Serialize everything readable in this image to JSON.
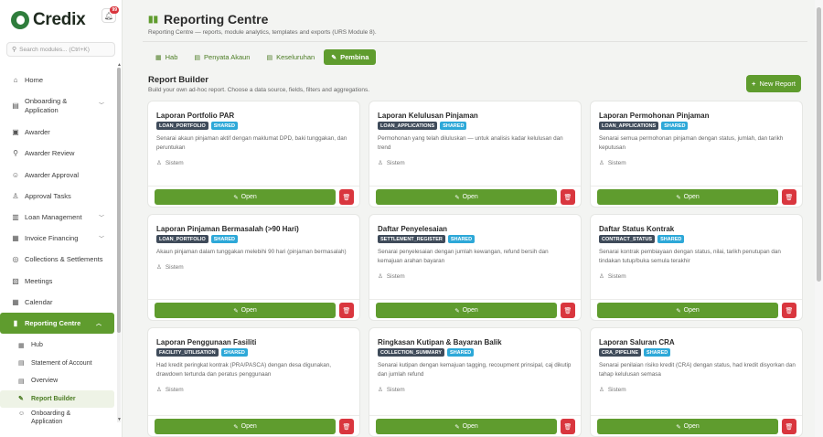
{
  "brand": {
    "name": "Credix",
    "notif_count": "99"
  },
  "search": {
    "placeholder": "Search modules... (Ctrl+K)"
  },
  "sidebar": {
    "items": [
      {
        "label": "Home",
        "icon": "home-icon",
        "glyph": "⌂"
      },
      {
        "label": "Onboarding & Application",
        "icon": "document-icon",
        "glyph": "▤",
        "chevron": true
      },
      {
        "label": "Awarder",
        "icon": "clipboard-icon",
        "glyph": "▣"
      },
      {
        "label": "Awarder Review",
        "icon": "user-search-icon",
        "glyph": "⚲"
      },
      {
        "label": "Awarder Approval",
        "icon": "user-check-icon",
        "glyph": "☺"
      },
      {
        "label": "Approval Tasks",
        "icon": "user-icon",
        "glyph": "♙"
      },
      {
        "label": "Loan Management",
        "icon": "bank-icon",
        "glyph": "▥",
        "chevron": true
      },
      {
        "label": "Invoice Financing",
        "icon": "invoice-icon",
        "glyph": "▦",
        "chevron": true
      },
      {
        "label": "Collections & Settlements",
        "icon": "coins-icon",
        "glyph": "◎"
      },
      {
        "label": "Meetings",
        "icon": "meeting-icon",
        "glyph": "▧"
      },
      {
        "label": "Calendar",
        "icon": "calendar-icon",
        "glyph": "▦"
      },
      {
        "label": "Reporting Centre",
        "icon": "chart-icon",
        "glyph": "▮",
        "chevron": true
      }
    ],
    "sub_items": [
      {
        "label": "Hub",
        "icon": "grid-icon",
        "glyph": "▦"
      },
      {
        "label": "Statement of Account",
        "icon": "statement-icon",
        "glyph": "▤"
      },
      {
        "label": "Overview",
        "icon": "overview-icon",
        "glyph": "▤"
      },
      {
        "label": "Report Builder",
        "icon": "wrench-icon",
        "glyph": "✎"
      },
      {
        "label": "Onboarding & Application",
        "icon": "users-icon",
        "glyph": "☺"
      }
    ]
  },
  "page": {
    "title": "Reporting Centre",
    "subtitle": "Reporting Centre — reports, module analytics, templates and exports (URS Module 8).",
    "tabs": [
      {
        "label": "Hab",
        "glyph": "▦"
      },
      {
        "label": "Penyata Akaun",
        "glyph": "▤"
      },
      {
        "label": "Keseluruhan",
        "glyph": "▤"
      },
      {
        "label": "Pembina",
        "glyph": "✎"
      }
    ],
    "section_title": "Report Builder",
    "section_subtitle": "Build your own ad-hoc report. Choose a data source, fields, filters and aggregations.",
    "new_report_label": "New Report"
  },
  "labels": {
    "shared": "Shared",
    "owner": "Sistem",
    "open": "Open"
  },
  "reports": [
    {
      "title": "Laporan Portfolio PAR",
      "source": "LOAN_PORTFOLIO",
      "desc": "Senarai akaun pinjaman aktif dengan maklumat DPD, baki tunggakan, dan peruntukan"
    },
    {
      "title": "Laporan Kelulusan Pinjaman",
      "source": "LOAN_APPLICATIONS",
      "desc": "Permohonan yang telah diluluskan — untuk analisis kadar kelulusan dan trend"
    },
    {
      "title": "Laporan Permohonan Pinjaman",
      "source": "LOAN_APPLICATIONS",
      "desc": "Senarai semua permohonan pinjaman dengan status, jumlah, dan tarikh keputusan"
    },
    {
      "title": "Laporan Pinjaman Bermasalah (>90 Hari)",
      "source": "LOAN_PORTFOLIO",
      "desc": "Akaun pinjaman dalam tunggakan melebihi 90 hari (pinjaman bermasalah)"
    },
    {
      "title": "Daftar Penyelesaian",
      "source": "SETTLEMENT_REGISTER",
      "desc": "Senarai penyelesaian dengan jumlah kewangan, refund bersih dan kemajuan arahan bayaran"
    },
    {
      "title": "Daftar Status Kontrak",
      "source": "CONTRACT_STATUS",
      "desc": "Senarai kontrak pembiayaan dengan status, nilai, tarikh penutupan dan tindakan tutup/buka semula terakhir"
    },
    {
      "title": "Laporan Penggunaan Fasiliti",
      "source": "FACILITY_UTILISATION",
      "desc": "Had kredit peringkat kontrak (PRA/PASCA) dengan desa digunakan, drawdown tertunda dan peratus penggunaan"
    },
    {
      "title": "Ringkasan Kutipan & Bayaran Balik",
      "source": "COLLECTION_SUMMARY",
      "desc": "Senarai kutipan dengan kemajuan tagging, recoupment prinsipal, caj dikutip dan jumlah refund"
    },
    {
      "title": "Laporan Saluran CRA",
      "source": "CRA_PIPELINE",
      "desc": "Senarai penilaian risiko kredit (CRA) dengan status, had kredit disyorkan dan tahap kelulusan semasa"
    }
  ]
}
